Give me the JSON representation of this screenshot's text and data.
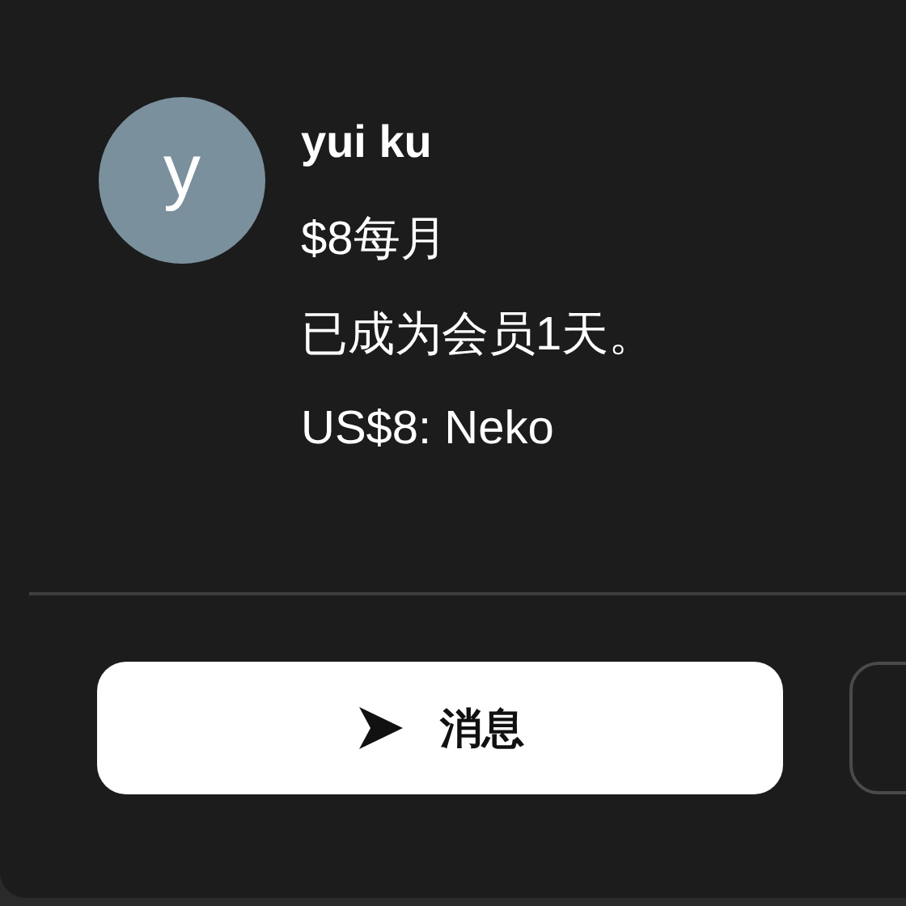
{
  "member": {
    "avatar_letter": "y",
    "name": "yui ku",
    "price": "$8每月",
    "duration": "已成为会员1天。",
    "tier": "US$8: Neko"
  },
  "buttons": [
    {
      "kind": "primary",
      "label": "消息"
    },
    {
      "kind": "outline"
    }
  ]
}
